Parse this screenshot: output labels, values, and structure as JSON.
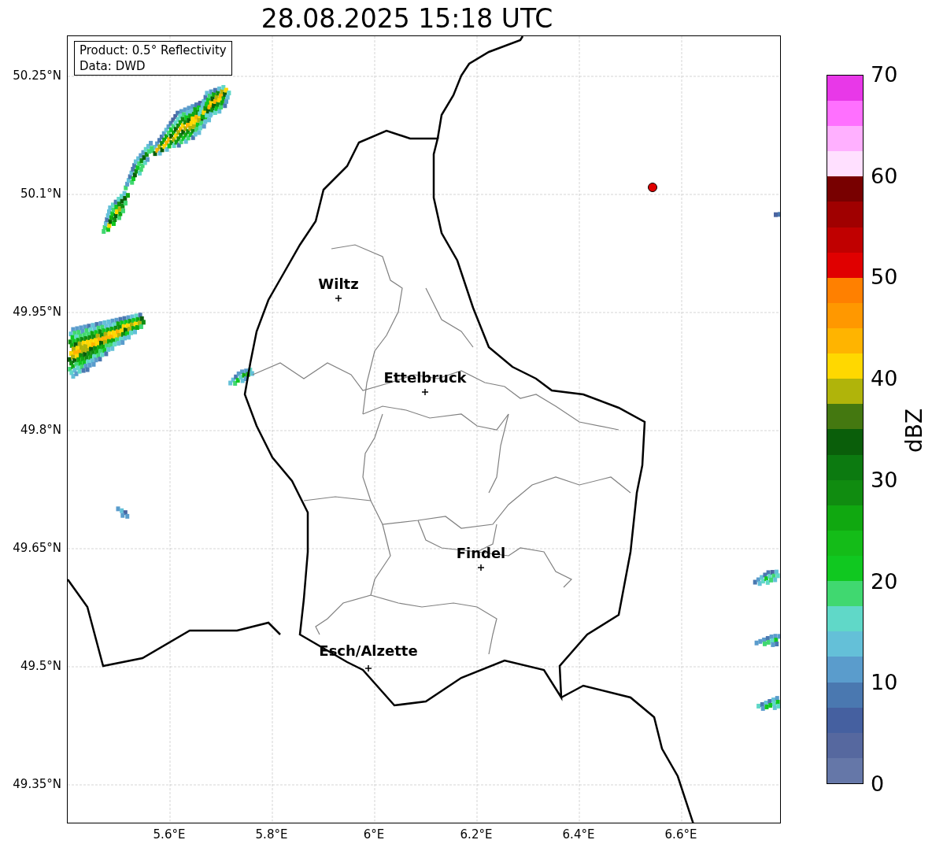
{
  "title": "28.08.2025 15:18 UTC",
  "info_box": {
    "lines": [
      "Product: 0.5° Reflectivity",
      "Data: DWD"
    ]
  },
  "lat_ticks": [
    "50.25°N",
    "50.1°N",
    "49.95°N",
    "49.8°N",
    "49.65°N",
    "49.5°N",
    "49.35°N"
  ],
  "lon_ticks": [
    "5.6°E",
    "5.8°E",
    "6°E",
    "6.2°E",
    "6.4°E",
    "6.6°E"
  ],
  "cities": [
    {
      "name": "Wiltz"
    },
    {
      "name": "Ettelbruck"
    },
    {
      "name": "Findel"
    },
    {
      "name": "Esch/Alzette"
    }
  ],
  "colorbar": {
    "label": "dBZ",
    "ticks": [
      "70",
      "60",
      "50",
      "40",
      "30",
      "20",
      "10",
      "0"
    ]
  }
}
